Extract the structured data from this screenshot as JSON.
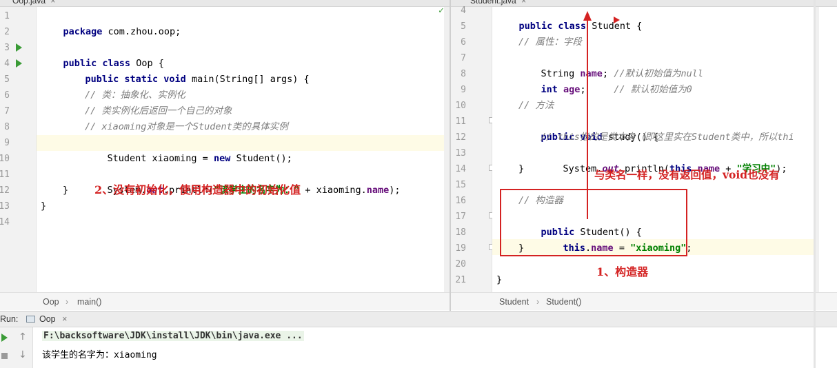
{
  "left_pane": {
    "tab_label": "Oop.java",
    "tab_close": "×",
    "breadcrumb": [
      "Oop",
      "main()"
    ],
    "breadcrumb_sep": "›",
    "lines": [
      "1",
      "2",
      "3",
      "4",
      "5",
      "6",
      "7",
      "8",
      "9",
      "10",
      "11",
      "12",
      "13",
      "14"
    ],
    "code": {
      "l1_kw": "package",
      "l1_rest": " com.zhou.oop;",
      "l3_kw": "public class",
      "l3_rest": " Oop {",
      "l4_kw": "public static void",
      "l4_rest": " main(String[] args) {",
      "l6": "// 类：抽象化、实例化",
      "l7": "// 类实例化后返回一个自己的对象",
      "l8": "// xiaoming对象是一个Student类的具体实例",
      "l9_a": "Student xiaoming = ",
      "l9_kw": "new",
      "l9_b": " Student();",
      "l11_a": "System.",
      "l11_out": "out",
      "l11_b": ".println(",
      "l11_str": "\"该学生的名字为：\"",
      "l11_c": " + xiaoming.",
      "l11_fld": "name",
      "l11_d": ");",
      "l12": "}",
      "l13": "}"
    },
    "annotation": "2、没有初始化，使用构造器中的初始化值"
  },
  "right_pane": {
    "tab_label": "Student.java",
    "tab_close": "×",
    "breadcrumb": [
      "Student",
      "Student()"
    ],
    "breadcrumb_sep": "›",
    "lines": [
      "4",
      "5",
      "6",
      "7",
      "8",
      "9",
      "10",
      "11",
      "12",
      "13",
      "14",
      "15",
      "16",
      "17",
      "18",
      "19",
      "20",
      "21"
    ],
    "code": {
      "l4_kw": "public class",
      "l4_rest": " Student {",
      "l6": "// 属性：字段",
      "l7_a": "String ",
      "l7_fld": "name",
      "l7_b": "; ",
      "l7_cm": "//默认初始值为null",
      "l8_kw": "int",
      "l8_sp": " ",
      "l8_fld": "age",
      "l8_b": ";     ",
      "l8_cm": "// 默认初始值为0",
      "l10": "// 方法",
      "l11_kw": "public void",
      "l11_rest": " study() {",
      "l12": "// this指的是类本身（即这里实在Student类中，所以thi",
      "l13_a": "System.",
      "l13_out": "out",
      "l13_b": ".println(",
      "l13_kw": "this",
      "l13_c": ".",
      "l13_fld": "name",
      "l13_d": " + ",
      "l13_str": "\"学习中\"",
      "l13_e": ");",
      "l14": "}",
      "l16": "// 构造器",
      "l17_kw": "public",
      "l17_rest": " Student() {",
      "l18_kw": "this",
      "l18_a": ".",
      "l18_fld": "name",
      "l18_b": " = ",
      "l18_str": "\"xiaoming\"",
      "l18_c": ";",
      "l19": "}",
      "l21": "}"
    },
    "annotation_top": "与类名一样，没有返回值，void也没有",
    "annotation_bottom": "1、构造器"
  },
  "run_panel": {
    "label": "Run:",
    "tab": "Oop",
    "tab_close": "×",
    "command": "F:\\backsoftware\\JDK\\install\\JDK\\bin\\java.exe ...",
    "output": "该学生的名字为：xiaoming"
  },
  "colors": {
    "annotation": "#d42222",
    "keyword": "#000080",
    "string": "#008000",
    "field": "#660e7a",
    "comment": "#808080",
    "current_line": "#fefbe6"
  }
}
